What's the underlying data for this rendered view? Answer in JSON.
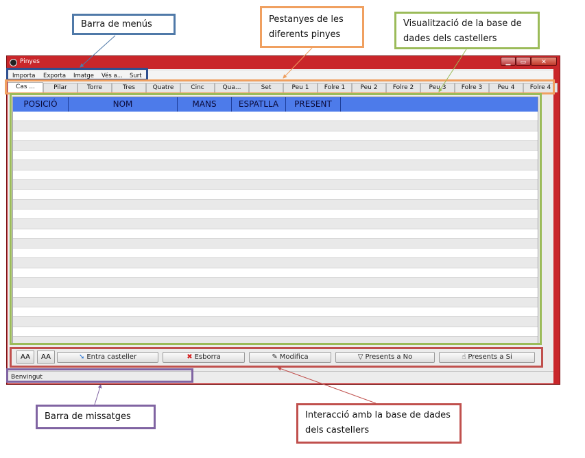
{
  "window": {
    "title": "Pinyes",
    "min_label": "▁",
    "max_label": "▭",
    "close_label": "✕"
  },
  "menubar": {
    "items": [
      "Importa",
      "Exporta",
      "Imatge",
      "Vés a...",
      "Surt"
    ]
  },
  "tabs": [
    "Cas ...",
    "Pilar",
    "Torre",
    "Tres",
    "Quatre",
    "Cinc",
    "Qua...",
    "Set",
    "Peu 1",
    "Folre 1",
    "Peu 2",
    "Folre 2",
    "Peu 3",
    "Folre 3",
    "Peu 4",
    "Folre 4"
  ],
  "active_tab_index": 0,
  "grid": {
    "columns": [
      "POSICIÓ",
      "NOM",
      "MANS",
      "ESPATLLA",
      "PRESENT"
    ],
    "header_color": "#4d7bea"
  },
  "font_buttons": {
    "increase": "AA",
    "decrease": "AA"
  },
  "actions": {
    "add": {
      "label": "Entra casteller",
      "icon": "arrow-icon"
    },
    "delete": {
      "label": "Esborra",
      "icon": "red-x-icon"
    },
    "edit": {
      "label": "Modifica",
      "icon": "edit-icon"
    },
    "absent": {
      "label": "Presents a No",
      "icon": "filter-icon"
    },
    "present": {
      "label": "Presents a Si",
      "icon": "hand-icon"
    }
  },
  "statusbar": {
    "text": "Benvingut"
  },
  "annotations": {
    "menubar": "Barra de menús",
    "tabs": "Pestanyes de les diferents pinyes",
    "database": "Visualització de la base de dades dels castellers",
    "messages": "Barra de missatges",
    "interaction": "Interacció amb la base de dades dels castellers"
  },
  "colors": {
    "window_frame": "#c9262a",
    "menubar_note": "#4f79a8",
    "tabs_note": "#f0a060",
    "database_note": "#9bbb59",
    "messages_note": "#8064a2",
    "interaction_note": "#c0504d"
  }
}
